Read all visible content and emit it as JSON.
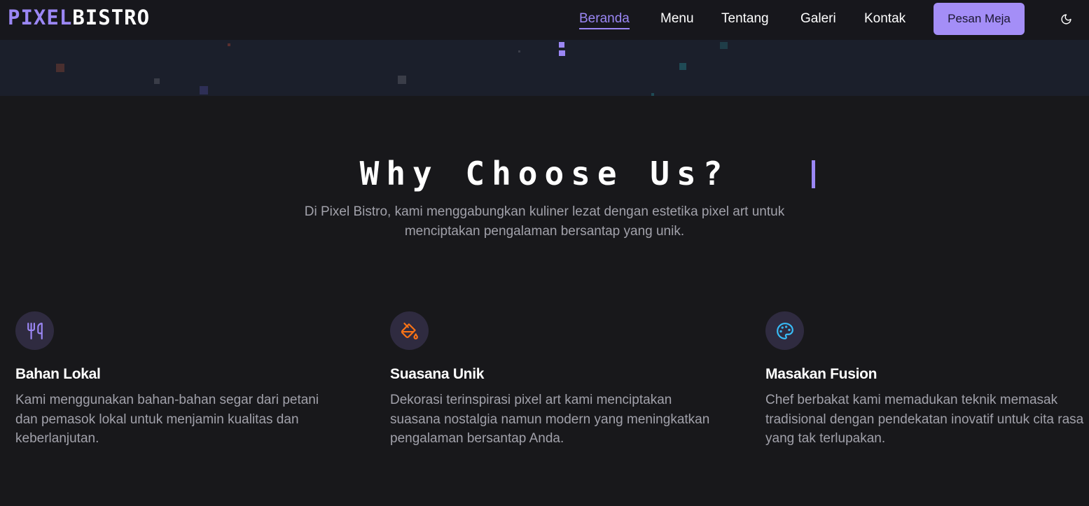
{
  "brand": {
    "part1": "PIXEL",
    "part2": "BISTRO",
    "accent_color": "#9b87f5"
  },
  "nav": {
    "items": [
      {
        "label": "Beranda",
        "active": true
      },
      {
        "label": "Menu",
        "active": false
      },
      {
        "label": "Tentang",
        "active": false
      },
      {
        "label": "Galeri",
        "active": false
      },
      {
        "label": "Kontak",
        "active": false
      }
    ],
    "cta_label": "Pesan Meja",
    "theme_icon": "moon-icon"
  },
  "section": {
    "title": "Why Choose Us?",
    "subtitle": "Di Pixel Bistro, kami menggabungkan kuliner lezat dengan estetika pixel art untuk menciptakan pengalaman bersantap yang unik."
  },
  "features": [
    {
      "icon": "utensils-icon",
      "icon_color": "#9b87f5",
      "title": "Bahan Lokal",
      "description": "Kami menggunakan bahan-bahan segar dari petani dan pemasok lokal untuk menjamin kualitas dan keberlanjutan."
    },
    {
      "icon": "paint-bucket-icon",
      "icon_color": "#f97316",
      "title": "Suasana Unik",
      "description": "Dekorasi terinspirasi pixel art kami menciptakan suasana nostalgia namun modern yang meningkatkan pengalaman bersantap Anda."
    },
    {
      "icon": "palette-icon",
      "icon_color": "#38bdf8",
      "title": "Masakan Fusion",
      "description": "Chef berbakat kami memadukan teknik memasak tradisional dengan pendekatan inovatif untuk cita rasa yang tak terlupakan."
    }
  ]
}
